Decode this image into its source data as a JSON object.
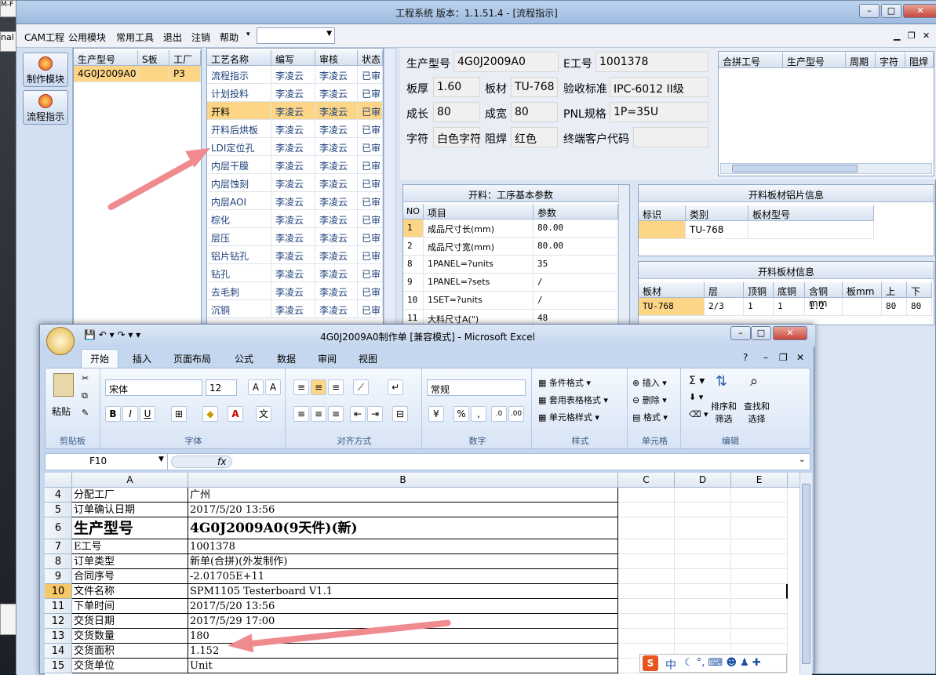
{
  "desktop": {
    "left_labels": [
      "M-F",
      "nal"
    ]
  },
  "cam_window": {
    "title": "工程系统   版本：1.1.51.4 - [流程指示]",
    "menu": [
      "CAM工程",
      "公用模块",
      "常用工具",
      "退出",
      "注销",
      "帮助"
    ],
    "menu_dropdown_arrow": "▾",
    "tools": [
      {
        "label": "制作模块",
        "icon": "fire-icon"
      },
      {
        "label": "流程指示",
        "icon": "flow-icon"
      }
    ],
    "order_grid": {
      "headers": [
        "生产型号",
        "S板",
        "工厂"
      ],
      "rows": [
        [
          "4G0J2009A0",
          "",
          "P3"
        ]
      ]
    },
    "process_grid": {
      "headers": [
        "工艺名称",
        "编写",
        "审核",
        "状态"
      ],
      "rows": [
        [
          "流程指示",
          "李凌云",
          "李凌云",
          "已审"
        ],
        [
          "计划投料",
          "李凌云",
          "李凌云",
          "已审"
        ],
        [
          "开料",
          "李凌云",
          "李凌云",
          "已审"
        ],
        [
          "开料后烘板",
          "李凌云",
          "李凌云",
          "已审"
        ],
        [
          "LDI定位孔",
          "李凌云",
          "李凌云",
          "已审"
        ],
        [
          "内层干膜",
          "李凌云",
          "李凌云",
          "已审"
        ],
        [
          "内层蚀刻",
          "李凌云",
          "李凌云",
          "已审"
        ],
        [
          "内层AOI",
          "李凌云",
          "李凌云",
          "已审"
        ],
        [
          "棕化",
          "李凌云",
          "李凌云",
          "已审"
        ],
        [
          "层压",
          "李凌云",
          "李凌云",
          "已审"
        ],
        [
          "铝片钻孔",
          "李凌云",
          "李凌云",
          "已审"
        ],
        [
          "钻孔",
          "李凌云",
          "李凌云",
          "已审"
        ],
        [
          "去毛刺",
          "李凌云",
          "李凌云",
          "已审"
        ],
        [
          "沉铜",
          "李凌云",
          "李凌云",
          "已审"
        ]
      ],
      "selected_index": 2
    },
    "info": {
      "prod_model_label": "生产型号",
      "prod_model": "4G0J2009A0",
      "e_no_label": "E工号",
      "e_no": "1001378",
      "thickness_label": "板厚",
      "thickness": "1.60",
      "material_label": "板材",
      "material": "TU-768",
      "standard_label": "验收标准",
      "standard": "IPC-6012 II级",
      "length_label": "成长",
      "length": "80",
      "width_label": "成宽",
      "width": "80",
      "pnl_label": "PNL规格",
      "pnl": "1P=35U",
      "silk_label": "字符",
      "silk": "白色字符",
      "mask_label": "阻焊",
      "mask": "红色",
      "customer_label": "终端客户代码",
      "customer": ""
    },
    "merge_grid": {
      "headers": [
        "合拼工号",
        "生产型号",
        "周期",
        "字符",
        "阻焊"
      ]
    },
    "params": {
      "title": "开料：工序基本参数",
      "headers": [
        "NO",
        "项目",
        "参数"
      ],
      "rows": [
        [
          "1",
          "成品尺寸长(mm)",
          "80.00"
        ],
        [
          "2",
          "成品尺寸宽(mm)",
          "80.00"
        ],
        [
          "8",
          "1PANEL=?units",
          "35"
        ],
        [
          "9",
          "1PANEL=?sets",
          "/"
        ],
        [
          "10",
          "1SET=?units",
          "/"
        ],
        [
          "11",
          "大料尺寸A(\")",
          "48"
        ]
      ]
    },
    "sheet_info": {
      "title": "开料板材铝片信息",
      "headers": [
        "标识",
        "类别",
        "板材型号"
      ],
      "rows": [
        [
          "",
          "TU-768",
          ""
        ]
      ]
    },
    "board_info": {
      "title": "开料板材信息",
      "headers": [
        "板材",
        "层",
        "顶铜",
        "底铜",
        "含铜mm",
        "板mm",
        "上",
        "下"
      ],
      "rows": [
        [
          "TU-768",
          "2/3",
          "1",
          "1",
          "1.2",
          "",
          "80",
          "80"
        ]
      ]
    }
  },
  "excel": {
    "title": "4G0J2009A0制作单  [兼容模式] - Microsoft Excel",
    "tabs": [
      "开始",
      "插入",
      "页面布局",
      "公式",
      "数据",
      "审阅",
      "视图"
    ],
    "ribbon": {
      "paste": "粘贴",
      "clipboard": "剪贴板",
      "font_name": "宋体",
      "font_size": "12",
      "font": "字体",
      "align": "对齐方式",
      "number_format": "常规",
      "number": "数字",
      "cond_format": "条件格式",
      "table_format": "套用表格格式",
      "cell_style": "单元格样式",
      "styles": "样式",
      "insert": "插入",
      "delete": "删除",
      "format": "格式",
      "cells": "单元格",
      "sort_filter": "排序和\n筛选",
      "find_select": "查找和\n选择",
      "editing": "编辑"
    },
    "name_box": "F10",
    "fx": "fx",
    "columns": [
      "A",
      "B",
      "C",
      "D",
      "E"
    ],
    "rows": [
      {
        "n": "4",
        "a": "分配工厂",
        "b": "广州"
      },
      {
        "n": "5",
        "a": "订单确认日期",
        "b": "2017/5/20 13:56"
      },
      {
        "n": "6",
        "a": "生产型号",
        "b": "4G0J2009A0(9天件)(新)"
      },
      {
        "n": "7",
        "a": "E工号",
        "b": "1001378"
      },
      {
        "n": "8",
        "a": "订单类型",
        "b": "新单(合拼)(外发制作)"
      },
      {
        "n": "9",
        "a": "合同序号",
        "b": "-2.01705E+11"
      },
      {
        "n": "10",
        "a": "文件名称",
        "b": "SPM1105 Testerboard V1.1"
      },
      {
        "n": "11",
        "a": "下单时间",
        "b": "2017/5/20 13:56"
      },
      {
        "n": "12",
        "a": "交货日期",
        "b": "2017/5/29 17:00"
      },
      {
        "n": "13",
        "a": "交货数量",
        "b": "180"
      },
      {
        "n": "14",
        "a": "交货面积",
        "b": "1.152"
      },
      {
        "n": "15",
        "a": "交货单位",
        "b": "Unit"
      }
    ],
    "ime": "中"
  }
}
